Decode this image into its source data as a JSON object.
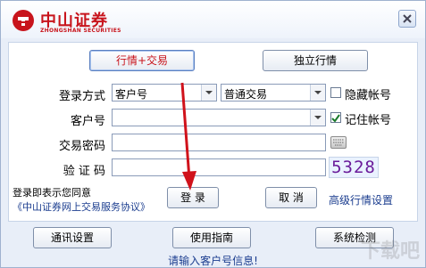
{
  "brand": {
    "name_cn": "中山证券",
    "name_en": "ZHONGSHAN SECURITIES"
  },
  "modes": {
    "trade_quote": "行情+交易",
    "quote_only": "独立行情"
  },
  "form": {
    "login_method_label": "登录方式",
    "login_method_value": "客户号",
    "trade_type_value": "普通交易",
    "hide_account_label": "隐藏帐号",
    "hide_account_checked": false,
    "account_label": "客户号",
    "account_value": "",
    "remember_account_label": "记住帐号",
    "remember_account_checked": true,
    "password_label": "交易密码",
    "captcha_label": "验 证 码",
    "captcha_value": "",
    "captcha_code": "5328"
  },
  "notice": {
    "line1": "登录即表示您同意",
    "line2": "《中山证券网上交易服务协议》"
  },
  "actions": {
    "login": "登 录",
    "cancel": "取 消",
    "advanced": "高级行情设置"
  },
  "footer": {
    "comm_settings": "通讯设置",
    "guide": "使用指南",
    "system_check": "系统检测"
  },
  "status": "请输入客户号信息!",
  "colors": {
    "brand_red": "#c8141c",
    "link_blue": "#1b3d8f",
    "annotation_arrow": "#d0121b"
  },
  "watermark": "下载吧"
}
